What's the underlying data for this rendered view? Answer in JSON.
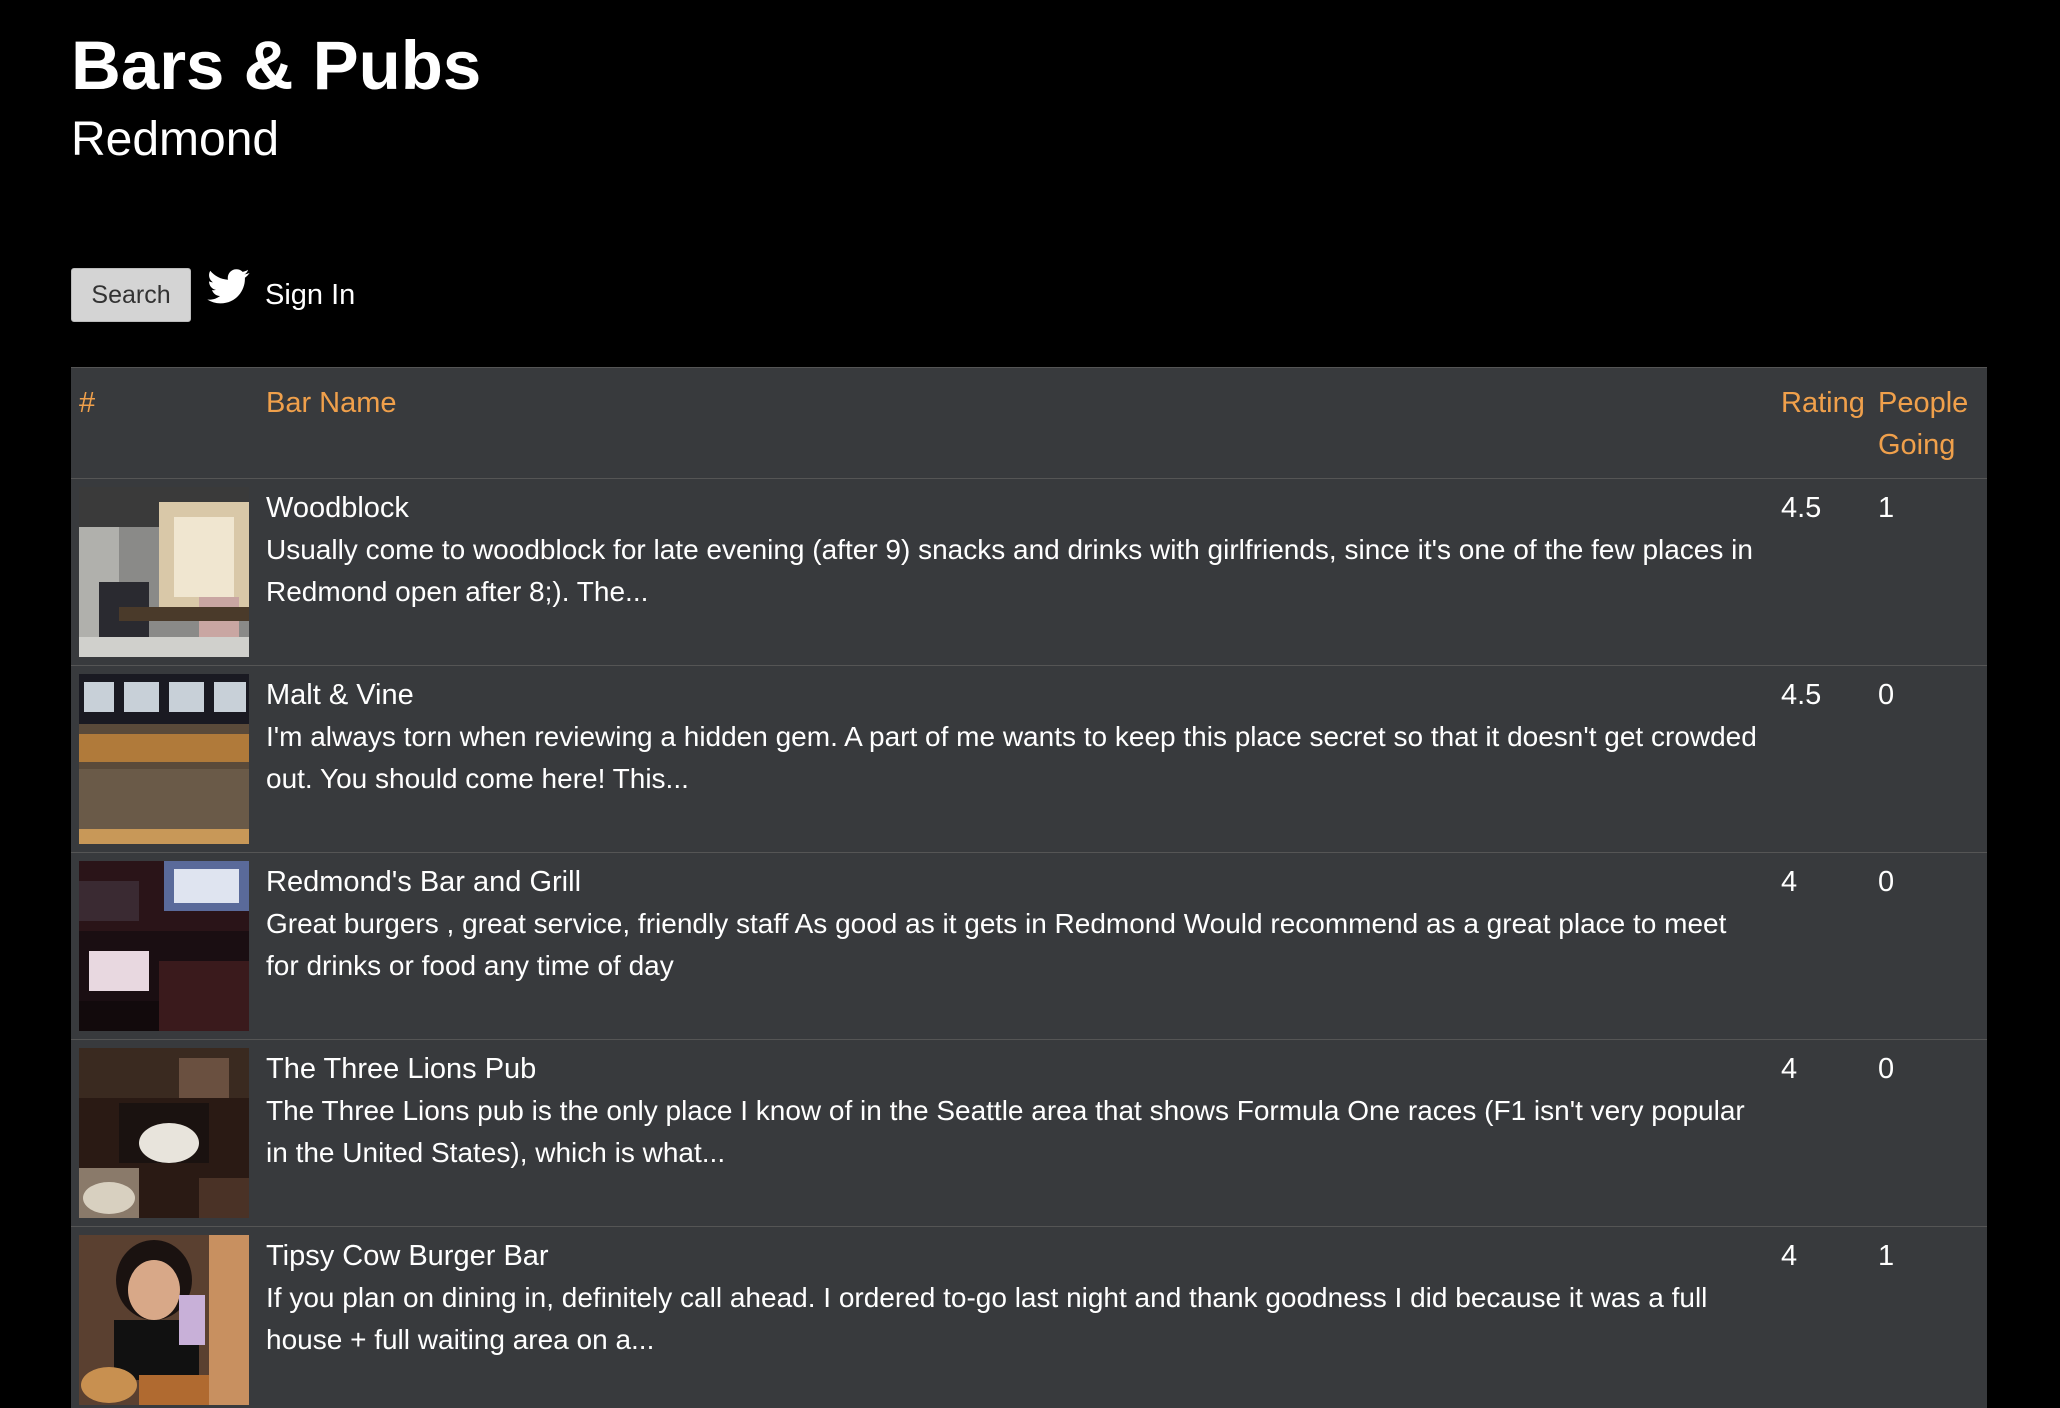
{
  "header": {
    "title": "Bars & Pubs",
    "subtitle": "Redmond"
  },
  "toolbar": {
    "search_label": "Search",
    "signin_label": "Sign In",
    "signin_icon": "twitter-bird-icon"
  },
  "table": {
    "columns": {
      "index": "#",
      "name": "Bar Name",
      "rating": "Rating",
      "going": "People Going"
    },
    "rows": [
      {
        "name": "Woodblock",
        "description": "Usually come to woodblock for late evening (after 9) snacks and drinks with girlfriends, since it's one of the few places in Redmond open after 8;). The...",
        "rating": "4.5",
        "going": "1"
      },
      {
        "name": "Malt & Vine",
        "description": "I'm always torn when reviewing a hidden gem. A part of me wants to keep this place secret so that it doesn't get crowded out. You should come here! This...",
        "rating": "4.5",
        "going": "0"
      },
      {
        "name": "Redmond's Bar and Grill",
        "description": "Great burgers , great service, friendly staff As good as it gets in Redmond Would recommend as a great place to meet for drinks or food any time of day",
        "rating": "4",
        "going": "0"
      },
      {
        "name": "The Three Lions Pub",
        "description": "The Three Lions pub is the only place I know of in the Seattle area that shows Formula One races (F1 isn't very popular in the United States), which is what...",
        "rating": "4",
        "going": "0"
      },
      {
        "name": "Tipsy Cow Burger Bar",
        "description": "If you plan on dining in, definitely call ahead. I ordered to-go last night and thank goodness I did because it was a full house + full waiting area on a...",
        "rating": "4",
        "going": "1"
      }
    ]
  },
  "colors": {
    "background": "#000000",
    "table_bg": "#383a3d",
    "header_accent": "#f0a04b",
    "text": "#ffffff"
  }
}
